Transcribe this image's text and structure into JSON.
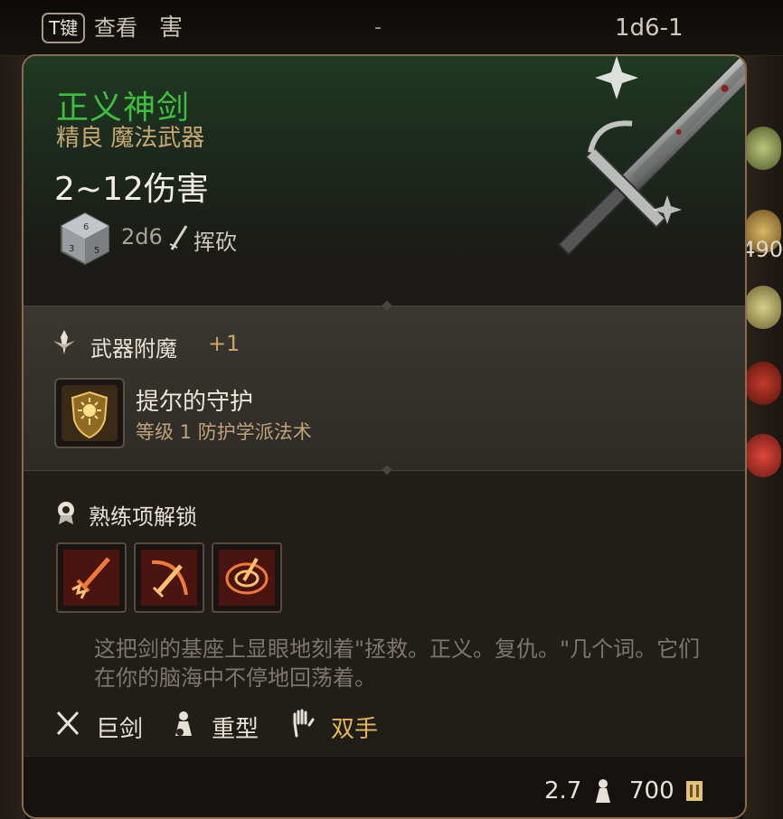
{
  "top_bar": {
    "key_label": "T键",
    "hint_label": "查看",
    "hint_truncated": "害",
    "dash": "-",
    "dice": "1d6-1"
  },
  "side": {
    "number": "490"
  },
  "item": {
    "name": "正义神剑",
    "type": "精良 魔法武器",
    "damage_range": "2~12伤害",
    "dice": "2d6",
    "damage_type": "挥砍",
    "name_color": "#3fbf3f",
    "type_color": "#c7a872"
  },
  "enchant": {
    "title": "武器附魔",
    "bonus": "+1"
  },
  "spell": {
    "name": "提尔的守护",
    "description": "等级 1 防护学派法术",
    "icon": "shield-sun-icon"
  },
  "proficiency": {
    "title": "熟练项解锁",
    "actions": [
      {
        "icon": "sword-strike-icon"
      },
      {
        "icon": "slash-arc-icon"
      },
      {
        "icon": "whirlwind-icon"
      }
    ]
  },
  "flavor": "这把剑的基座上显眼地刻着\"拯救。正义。复仇。\"几个词。它们在你的脑海中不停地回荡着。",
  "tags": {
    "category": "巨剑",
    "weight_class": "重型",
    "handedness": "双手",
    "handedness_color": "#e3b85a"
  },
  "footer": {
    "weight": "2.7",
    "price": "700"
  }
}
